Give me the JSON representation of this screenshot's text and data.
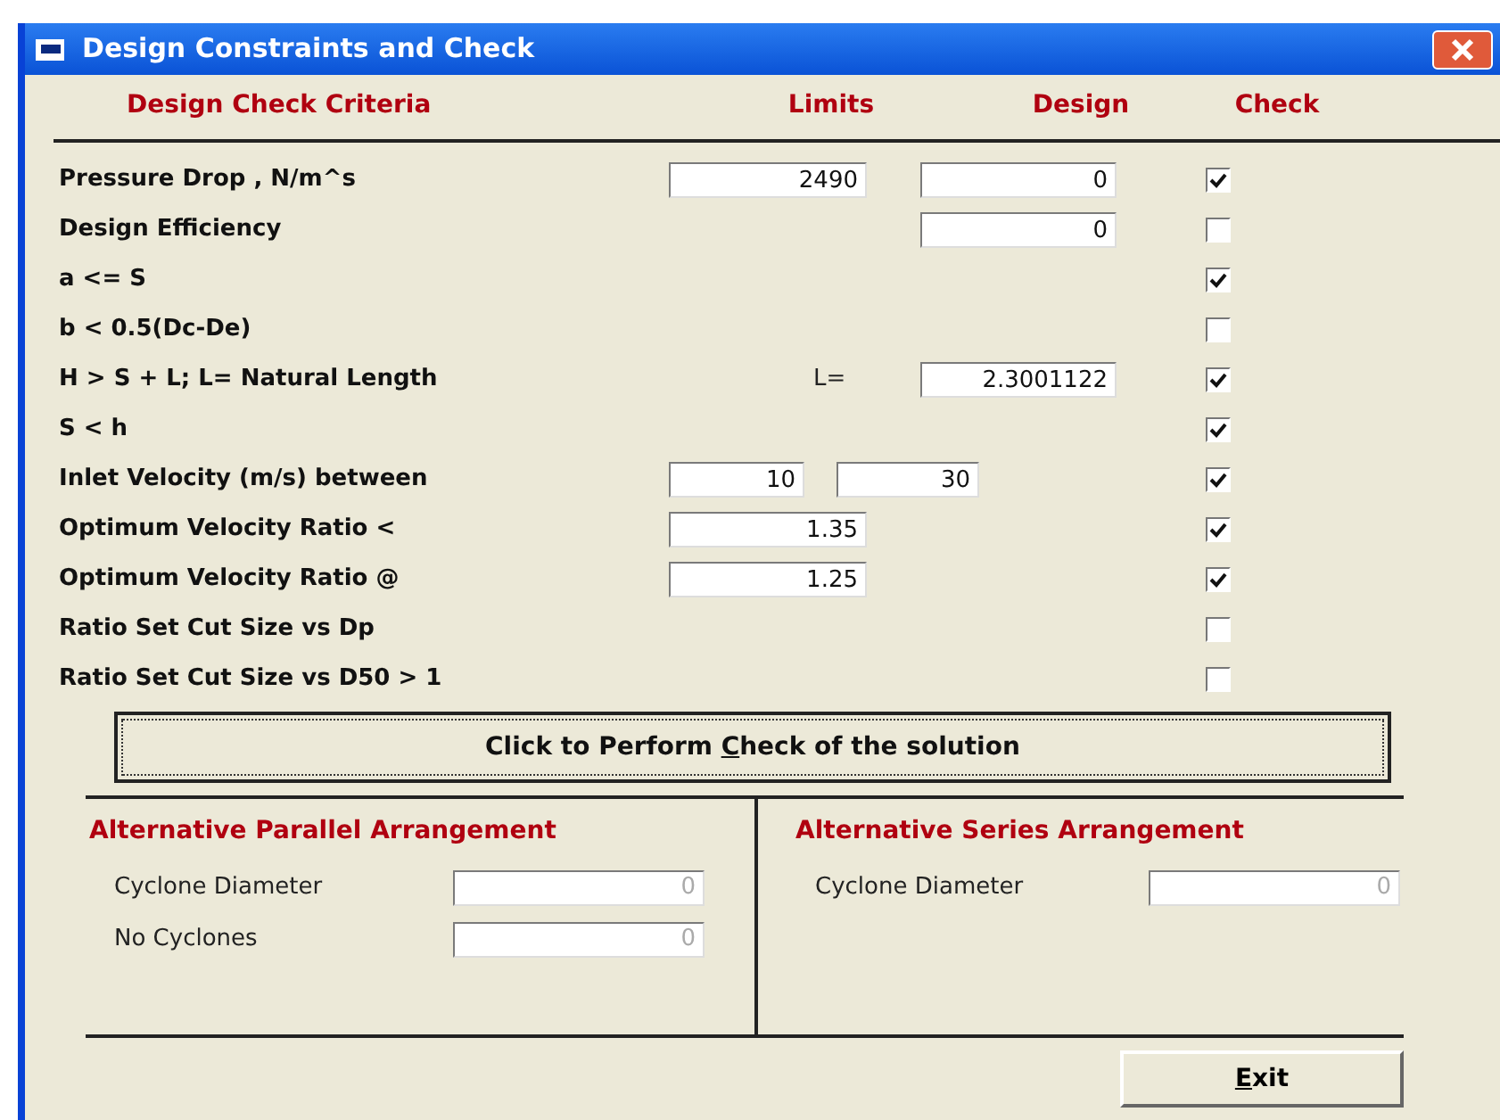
{
  "window": {
    "title": "Design Constraints and Check"
  },
  "columns": [
    "Design Check Criteria",
    "Limits",
    "Design",
    "Check"
  ],
  "rows": [
    {
      "label": "Pressure Drop , N/m^s",
      "limits": [
        "2490"
      ],
      "design": "0",
      "checked": true
    },
    {
      "label": "Design Efficiency",
      "design": "0",
      "checked": false
    },
    {
      "label": "a <= S",
      "checked": true
    },
    {
      "label": "b < 0.5(Dc-De)",
      "checked": false
    },
    {
      "label": "H > S + L; L= Natural Length",
      "design_prefix": "L=",
      "design": "2.3001122",
      "checked": true
    },
    {
      "label": "S < h",
      "checked": true
    },
    {
      "label": "Inlet Velocity (m/s) between",
      "limits": [
        "10",
        "30"
      ],
      "checked": true
    },
    {
      "label": "Optimum Velocity Ratio <",
      "limits": [
        "1.35"
      ],
      "checked": true
    },
    {
      "label": "Optimum Velocity Ratio @",
      "limits": [
        "1.25"
      ],
      "checked": true
    },
    {
      "label": "Ratio Set Cut Size vs Dp",
      "checked": false
    },
    {
      "label": "Ratio Set Cut Size vs D50 > 1",
      "checked": false
    }
  ],
  "check_button": {
    "label_before": "Click to Perform ",
    "hotkey": "C",
    "label_after": "heck of the solution"
  },
  "sections": [
    {
      "title": "Alternative Parallel Arrangement",
      "fields": [
        {
          "label": "Cyclone Diameter",
          "value": "0",
          "disabled": true
        },
        {
          "label": "No Cyclones",
          "value": "0",
          "disabled": true
        }
      ]
    },
    {
      "title": "Alternative Series Arrangement",
      "fields": [
        {
          "label": "Cyclone Diameter",
          "value": "0",
          "disabled": true
        }
      ]
    }
  ],
  "exit_button": {
    "hotkey": "E",
    "label_after": "xit"
  }
}
